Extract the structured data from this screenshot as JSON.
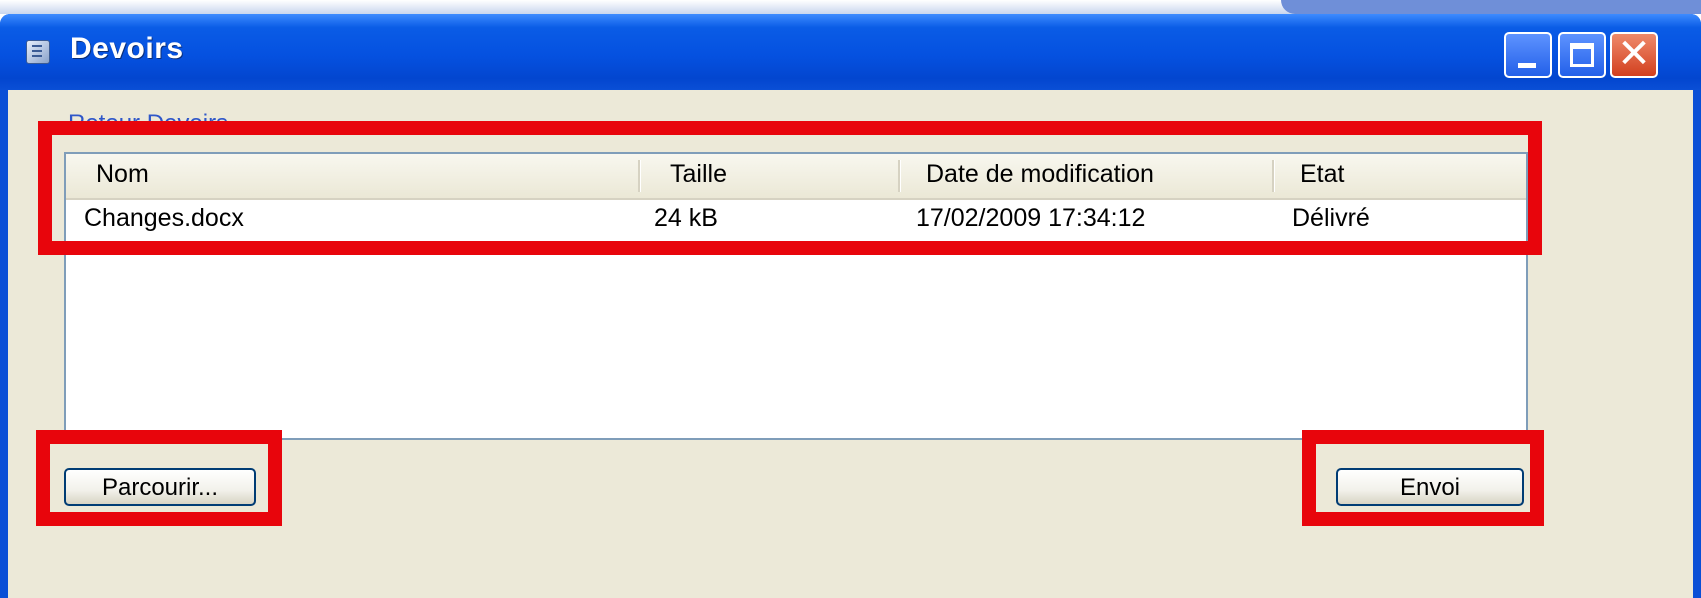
{
  "window": {
    "title": "Devoirs",
    "close_glyph": "✕"
  },
  "back_link": "Retour Devoirs",
  "columns": [
    "Nom",
    "Taille",
    "Date de modification",
    "Etat"
  ],
  "files": [
    {
      "name": "Changes.docx",
      "size": "24 kB",
      "modified": "17/02/2009 17:34:12",
      "status": "Délivré"
    }
  ],
  "buttons": {
    "browse_label": "Parcourir...",
    "send_label": "Envoi"
  },
  "icons": {
    "app": "document-icon",
    "minimize": "minimize-icon",
    "maximize": "maximize-icon",
    "close": "close-icon"
  },
  "colors": {
    "titlebar": "#0551e0",
    "client_bg": "#ece9d8",
    "highlight": "#e8050c",
    "link": "#2f57c9"
  }
}
